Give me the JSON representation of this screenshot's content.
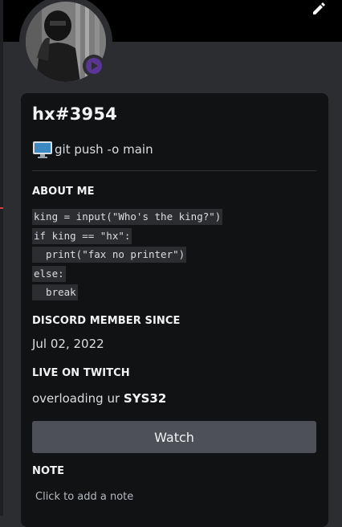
{
  "profile": {
    "username": "hx#3954",
    "status_icon": "purple-streaming-status",
    "custom_status": {
      "icon": "desktop-monitor-icon",
      "text": "git push -o main"
    }
  },
  "about_me": {
    "title": "ABOUT ME",
    "code_lines": [
      "king = input(\"Who's the king?\")",
      "if king == \"hx\":",
      "  print(\"fax no printer\")",
      "else:",
      "  break"
    ]
  },
  "member_since": {
    "title": "DISCORD MEMBER SINCE",
    "date": "Jul 02, 2022"
  },
  "twitch": {
    "title": "LIVE ON TWITCH",
    "stream_title_prefix": "overloading ur ",
    "stream_title_bold": "SYS32",
    "watch_label": "Watch"
  },
  "note": {
    "title": "NOTE",
    "placeholder": "Click to add a note"
  },
  "colors": {
    "background": "#2b2d31",
    "card": "#111214",
    "button": "#4e5058",
    "streaming": "#593695"
  }
}
